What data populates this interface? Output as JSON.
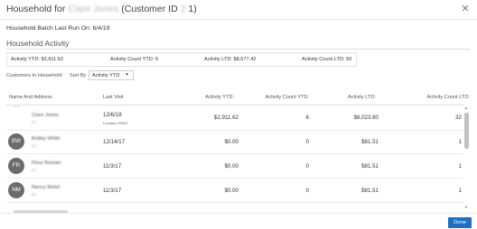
{
  "header": {
    "title_prefix": "Household for",
    "customer_name_blurred": "Clare Jones",
    "customer_id_label": "(Customer ID",
    "customer_id_blurred": "2",
    "customer_id_end": "1)",
    "close_icon": "close-icon"
  },
  "batch_text": "Household Batch Last Run On: 6/4/19",
  "activity": {
    "title": "Household Activity",
    "ytd": "Activity YTD: $2,911.62",
    "count_ytd": "Activity Count YTD: 6",
    "ltd": "Activity LTD: $8,677.42",
    "count_ltd": "Activity Count LTD: 50"
  },
  "controls": {
    "customers_label": "Customers In Household",
    "sort_label": "Sort By",
    "sort_value": "Activity YTD",
    "caret_icon": "chevron-down-icon"
  },
  "columns": [
    "Name And Address",
    "Last Visit",
    "Activity YTD:",
    "Activity Count YTD:",
    "Activity LTD:",
    "Activity Count LTD:"
  ],
  "rows": [
    {
      "initials": "",
      "name": "Clare Jones",
      "sub": "CT",
      "last_visit": "12/6/18",
      "location": "Location 99902",
      "ytd": "$2,911.62",
      "count_ytd": "6",
      "ltd": "$8,023.80",
      "count_ltd": "32"
    },
    {
      "initials": "BW",
      "name": "Bobby White",
      "sub": "CT",
      "last_visit": "12/14/17",
      "location": "",
      "ytd": "$0.00",
      "count_ytd": "0",
      "ltd": "$81.51",
      "count_ltd": "1"
    },
    {
      "initials": "FR",
      "name": "Fleur Roman",
      "sub": "CT",
      "last_visit": "11/3/17",
      "location": "",
      "ytd": "$0.00",
      "count_ytd": "0",
      "ltd": "$81.51",
      "count_ltd": "1"
    },
    {
      "initials": "NM",
      "name": "Nancy Motel",
      "sub": "CT",
      "last_visit": "11/3/17",
      "location": "",
      "ytd": "$0.00",
      "count_ytd": "0",
      "ltd": "$81.51",
      "count_ltd": "1"
    }
  ],
  "footer": {
    "done_label": "Done"
  },
  "colors": {
    "accent": "#1f6fc4",
    "avatar": "#6b6b6b"
  }
}
